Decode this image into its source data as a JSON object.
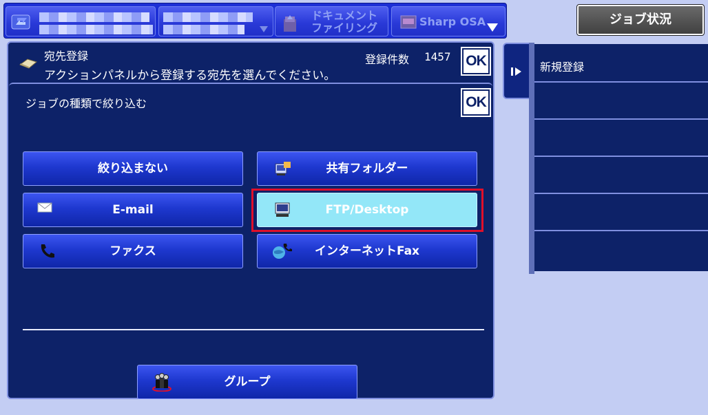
{
  "topbar": {
    "document_filing_label": "ドキュメント\nファイリング",
    "sharp_osa_label": "Sharp OSA",
    "job_status_label": "ジョブ状況"
  },
  "header": {
    "title": "宛先登録",
    "message": "アクションパネルから登録する宛先を選んでください。",
    "count_label": "登録件数",
    "count_value": "1457",
    "ok_label": "OK"
  },
  "filter": {
    "title": "ジョブの種類で絞り込む",
    "ok_label": "OK",
    "buttons": {
      "none": "絞り込まない",
      "shared_folder": "共有フォルダー",
      "email": "E-mail",
      "ftp_desktop": "FTP/Desktop",
      "fax": "ファクス",
      "internet_fax": "インターネットFax",
      "group": "グループ"
    },
    "selected": "ftp_desktop"
  },
  "right_panel": {
    "items": [
      "新規登録",
      "",
      "",
      "",
      "",
      ""
    ]
  },
  "colors": {
    "panel_bg": "#0d2268",
    "selected_button": "#93e7f8",
    "selection_frame": "#e0102a",
    "page_bg": "#c3cdf3"
  }
}
